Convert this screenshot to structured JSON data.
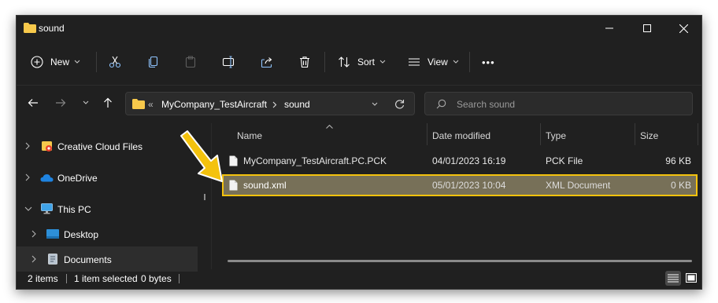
{
  "window": {
    "title": "sound"
  },
  "toolbar": {
    "new_label": "New",
    "sort_label": "Sort",
    "view_label": "View",
    "more_label": "•••"
  },
  "address": {
    "parent": "MyCompany_TestAircraft",
    "current": "sound",
    "overflow": "«"
  },
  "search": {
    "placeholder": "Search sound"
  },
  "sidebar": {
    "items": [
      {
        "label": "Creative Cloud Files",
        "icon": "creative-cloud-icon"
      },
      {
        "label": "OneDrive",
        "icon": "cloud-icon"
      },
      {
        "label": "This PC",
        "icon": "monitor-icon"
      },
      {
        "label": "Desktop",
        "icon": "desktop-icon"
      },
      {
        "label": "Documents",
        "icon": "documents-icon"
      }
    ]
  },
  "columns": {
    "name": "Name",
    "date": "Date modified",
    "type": "Type",
    "size": "Size"
  },
  "files": [
    {
      "name": "MyCompany_TestAircraft.PC.PCK",
      "date": "04/01/2023 16:19",
      "type": "PCK File",
      "size": "96 KB"
    },
    {
      "name": "sound.xml",
      "date": "05/01/2023 10:04",
      "type": "XML Document",
      "size": "0 KB"
    }
  ],
  "status": {
    "items": "2 items",
    "selected": "1 item selected",
    "size": "0 bytes"
  },
  "colors": {
    "highlight": "#f4c20d",
    "accent_folder": "#f8c94b",
    "window_bg": "#202020"
  }
}
